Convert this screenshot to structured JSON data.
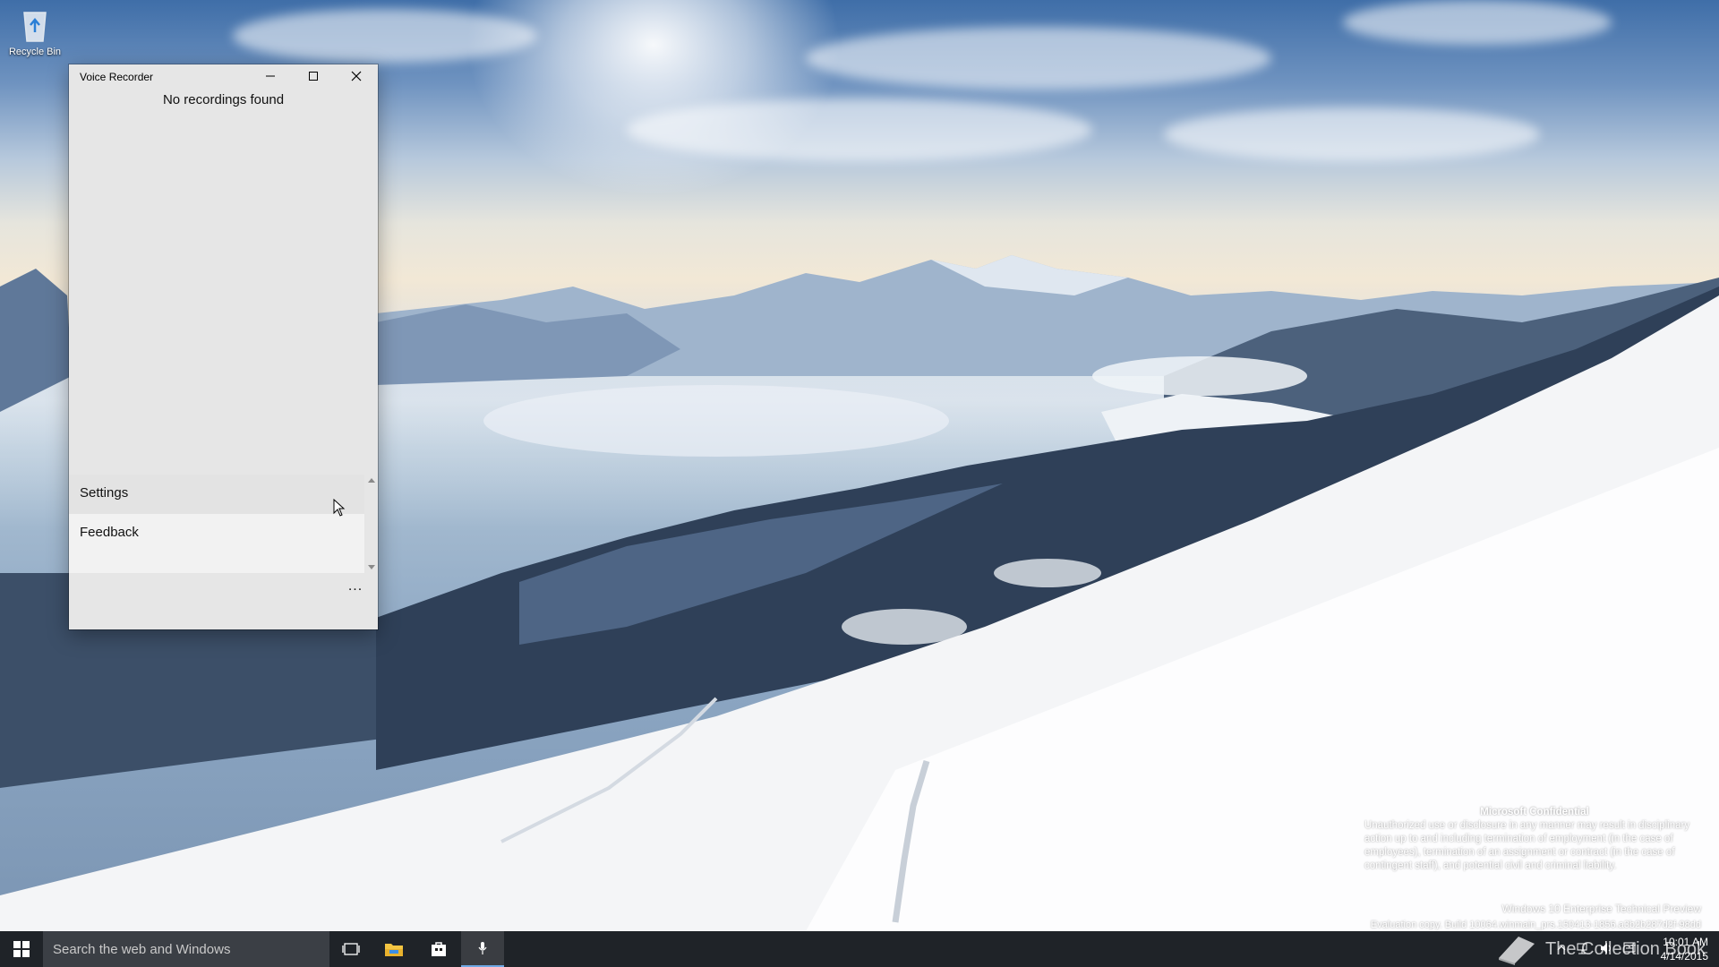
{
  "desktop": {
    "icons": [
      {
        "label": "Recycle Bin",
        "icon": "recycle-bin-icon"
      }
    ]
  },
  "window": {
    "title": "Voice Recorder",
    "empty_message": "No recordings found",
    "menu": [
      {
        "label": "Settings",
        "hover": true
      },
      {
        "label": "Feedback",
        "hover": false
      }
    ],
    "more_label": "..."
  },
  "watermark": {
    "title": "Microsoft Confidential",
    "body": "Unauthorized use or disclosure in any manner may result in disciplinary action up to and including termination of employment (in the case of employees), termination of an assignment or contract (in the case of contingent staff), and potential civil and criminal liability.",
    "edition": "Windows 10 Enterprise Technical Preview",
    "build": "Evaluation copy. Build 10064.winmain_prs.150413-1856.a3b2b287d2f-98dd"
  },
  "taskbar": {
    "search_placeholder": "Search the web and Windows",
    "apps": [
      {
        "name": "task-view",
        "icon": "task-view-icon"
      },
      {
        "name": "file-explorer",
        "icon": "folder-icon"
      },
      {
        "name": "store",
        "icon": "store-icon"
      },
      {
        "name": "voice-recorder",
        "icon": "microphone-icon",
        "active": true
      }
    ],
    "brand": "The Collection Book",
    "time": "10:01 AM",
    "date": "4/14/2015"
  },
  "colors": {
    "taskbar": "#0c1016",
    "window_bg": "#e6e6e6",
    "accent": "#6ea8e4"
  }
}
